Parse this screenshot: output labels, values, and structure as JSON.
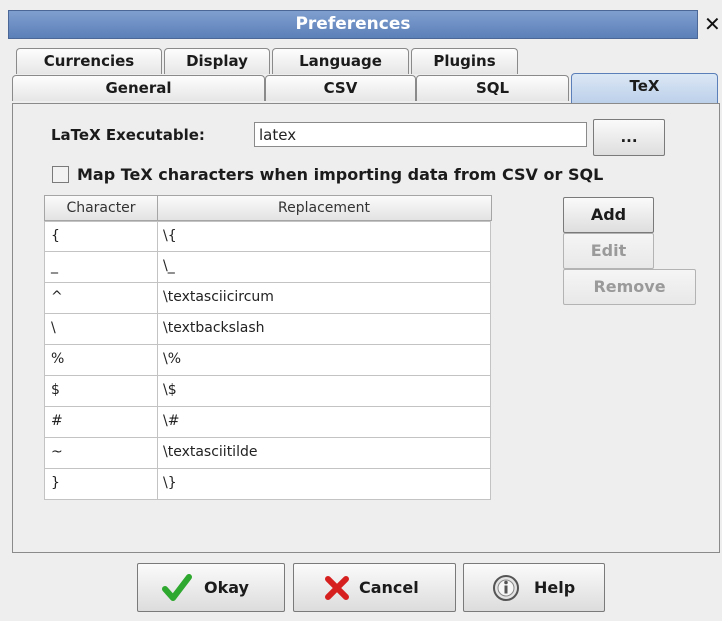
{
  "window": {
    "title": "Preferences",
    "close_glyph": "✕"
  },
  "tabs_row1": [
    {
      "label": "Currencies",
      "underline": "u"
    },
    {
      "label": "Display",
      "underline": "i"
    },
    {
      "label": "Language",
      "underline": "L"
    },
    {
      "label": "Plugins",
      "underline": "P"
    }
  ],
  "tabs_row2": [
    {
      "label": "General",
      "underline": "G"
    },
    {
      "label": "CSV",
      "underline": "V"
    },
    {
      "label": "SQL",
      "underline": "Q"
    },
    {
      "label": "TeX",
      "underline": "e",
      "selected": true
    }
  ],
  "latex": {
    "label": "LaTeX Executable:",
    "value": "latex",
    "browse_label": "..."
  },
  "map_option": {
    "label": "Map TeX characters when importing data from CSV or SQL",
    "checked": false
  },
  "table": {
    "headers": [
      "Character",
      "Replacement"
    ],
    "rows": [
      {
        "char": "{",
        "repl": "\\{"
      },
      {
        "char": "_",
        "repl": "\\_"
      },
      {
        "char": "^",
        "repl": "\\textasciicircum"
      },
      {
        "char": "\\",
        "repl": "\\textbackslash"
      },
      {
        "char": "%",
        "repl": "\\%"
      },
      {
        "char": "$",
        "repl": "\\$"
      },
      {
        "char": "#",
        "repl": "\\#"
      },
      {
        "char": "~",
        "repl": "\\textasciitilde"
      },
      {
        "char": "}",
        "repl": "\\}"
      }
    ]
  },
  "side_buttons": {
    "add": "Add",
    "edit": "Edit",
    "remove": "Remove"
  },
  "dialog_buttons": {
    "okay": "Okay",
    "cancel": "Cancel",
    "help": "Help"
  },
  "icons": {
    "okay": "checkmark-icon",
    "cancel": "cross-icon",
    "help": "help-icon"
  },
  "colors": {
    "title_bar": "#5b7fb8",
    "okay_icon": "#2ea82e",
    "cancel_icon": "#d62020",
    "selected_tab": "#bcd0ea"
  }
}
